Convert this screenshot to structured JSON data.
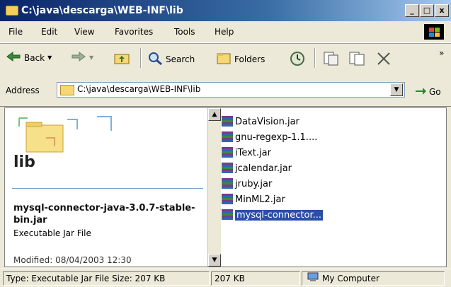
{
  "window": {
    "title": "C:\\java\\descarga\\WEB-INF\\lib",
    "controls": [
      "_",
      "□",
      "x"
    ]
  },
  "menu": [
    "File",
    "Edit",
    "View",
    "Favorites",
    "Tools",
    "Help"
  ],
  "toolbar": {
    "back_label": "Back",
    "search_label": "Search",
    "folders_label": "Folders",
    "overflow": "»"
  },
  "address": {
    "label": "Address",
    "value": "C:\\java\\descarga\\WEB-INF\\lib",
    "go_label": "Go"
  },
  "left_pane": {
    "folder_name": "lib",
    "selected_name": "mysql-connector-java-3.0.7-stable-bin.jar",
    "selected_type": "Executable Jar File",
    "modified": "Modified: 08/04/2003 12:30"
  },
  "files": [
    {
      "name": "DataVision.jar",
      "selected": false
    },
    {
      "name": "gnu-regexp-1.1....",
      "selected": false
    },
    {
      "name": "iText.jar",
      "selected": false
    },
    {
      "name": "jcalendar.jar",
      "selected": false
    },
    {
      "name": "jruby.jar",
      "selected": false
    },
    {
      "name": "MinML2.jar",
      "selected": false
    },
    {
      "name": "mysql-connector...",
      "selected": true
    }
  ],
  "status": {
    "info": "Type: Executable Jar File Size: 207 KB",
    "size": "207 KB",
    "zone": "My Computer"
  }
}
